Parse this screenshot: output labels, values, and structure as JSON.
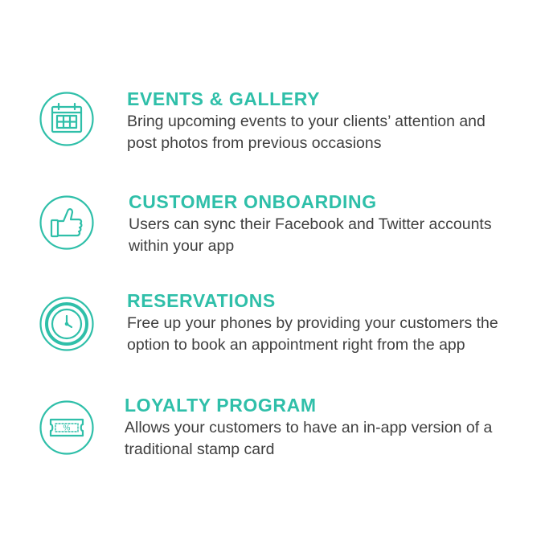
{
  "theme": {
    "accent": "#2fbfa9",
    "text": "#3f3f3f"
  },
  "features": [
    {
      "icon": "calendar-icon",
      "title": "EVENTS & GALLERY",
      "description": "Bring upcoming events to your clients’ attention and post photos from previous occasions"
    },
    {
      "icon": "thumbs-up-icon",
      "title": "CUSTOMER ONBOARDING",
      "description": "Users can sync their Facebook and Twitter accounts within your app"
    },
    {
      "icon": "clock-icon",
      "title": "RESERVATIONS",
      "description": "Free up your phones by providing your customers the option to book an appointment right from the app"
    },
    {
      "icon": "coupon-icon",
      "title": "LOYALTY PROGRAM",
      "description": "Allows your customers to have an in-app version of a traditional stamp card"
    }
  ],
  "coupon_symbol": "%"
}
